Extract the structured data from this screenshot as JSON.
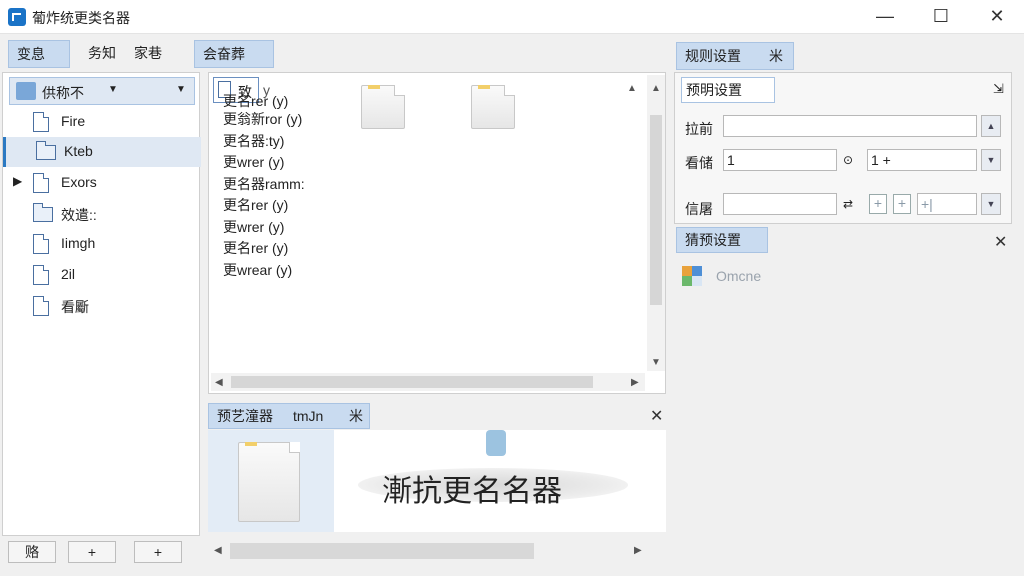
{
  "window": {
    "title": "葡炸统更类名器",
    "minimize": "—",
    "maximize": "☐",
    "close": "✕"
  },
  "toolbar_tabs": [
    {
      "label": "变息"
    },
    {
      "label": "务知"
    },
    {
      "label": "家巷"
    },
    {
      "label": "会奋葬"
    }
  ],
  "sidebar": {
    "dropdown_label": "供称不",
    "items": [
      {
        "label": "Fire"
      },
      {
        "label": "Kteb"
      },
      {
        "label": "Exors"
      },
      {
        "label": "效遣::"
      },
      {
        "label": "Iimgh"
      },
      {
        "label": "2il"
      },
      {
        "label": "看斸"
      }
    ],
    "bottom_buttons": [
      "赂",
      "+",
      "+"
    ]
  },
  "file_list": {
    "header": "致",
    "header_suffix": "y",
    "lines": [
      "更名rer (y)",
      "更翁新ror (y)",
      "更名器:ty)",
      "更wrer (y)",
      "更名器ramm:",
      "更名rer (y)",
      "更wrer (y)",
      "更名rer (y)",
      "更wrear (y)"
    ]
  },
  "preview": {
    "tab_label": "预艺潼器",
    "tab_extra": "tmJn",
    "tab_close": "米",
    "close": "✕",
    "banner_text": "漸抗更名名器"
  },
  "right_panel": {
    "header": "规则设置",
    "header_close": "米",
    "sub_header": "预明设置",
    "pin": "⇲",
    "label_1": "拉前",
    "label_2": "看储",
    "label_3": "信屠",
    "field_2_value": "1",
    "field_2b_value": "1  +",
    "pm_1": "+",
    "pm_2": "+",
    "pm_3": "+|",
    "preset_header": "猜预设置",
    "preset_close": "✕",
    "preset_item": "Omcne"
  },
  "colors": {
    "accent": "#2b79c2",
    "tab_active": "#c9dbf0"
  }
}
